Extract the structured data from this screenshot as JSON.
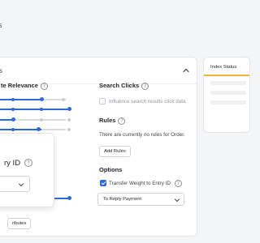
{
  "colors": {
    "accent": "#2f6bd8",
    "status_accent": "#f0b43c"
  },
  "header": {
    "stub": "s"
  },
  "card": {
    "header_stub": "s",
    "relevance_title": "te Relevance",
    "search_clicks": {
      "title": "Search Clicks",
      "checkbox_label": "Influence search results click data",
      "checked": false
    },
    "rules": {
      "title": "Rules",
      "empty_text": "There are currently no rules for Order.",
      "add_button": "Add Rules"
    },
    "options": {
      "title": "Options",
      "checkbox_label": "Transfer Weight to Entry ID",
      "checked": true,
      "select_value": "To Reply Payment"
    },
    "footer_button": "ributes"
  },
  "popover": {
    "title": "ry ID"
  },
  "index_status": {
    "title": "Index Status"
  },
  "icons": [
    "chevron-up-icon",
    "help-icon",
    "chevron-down-icon",
    "check-icon"
  ]
}
